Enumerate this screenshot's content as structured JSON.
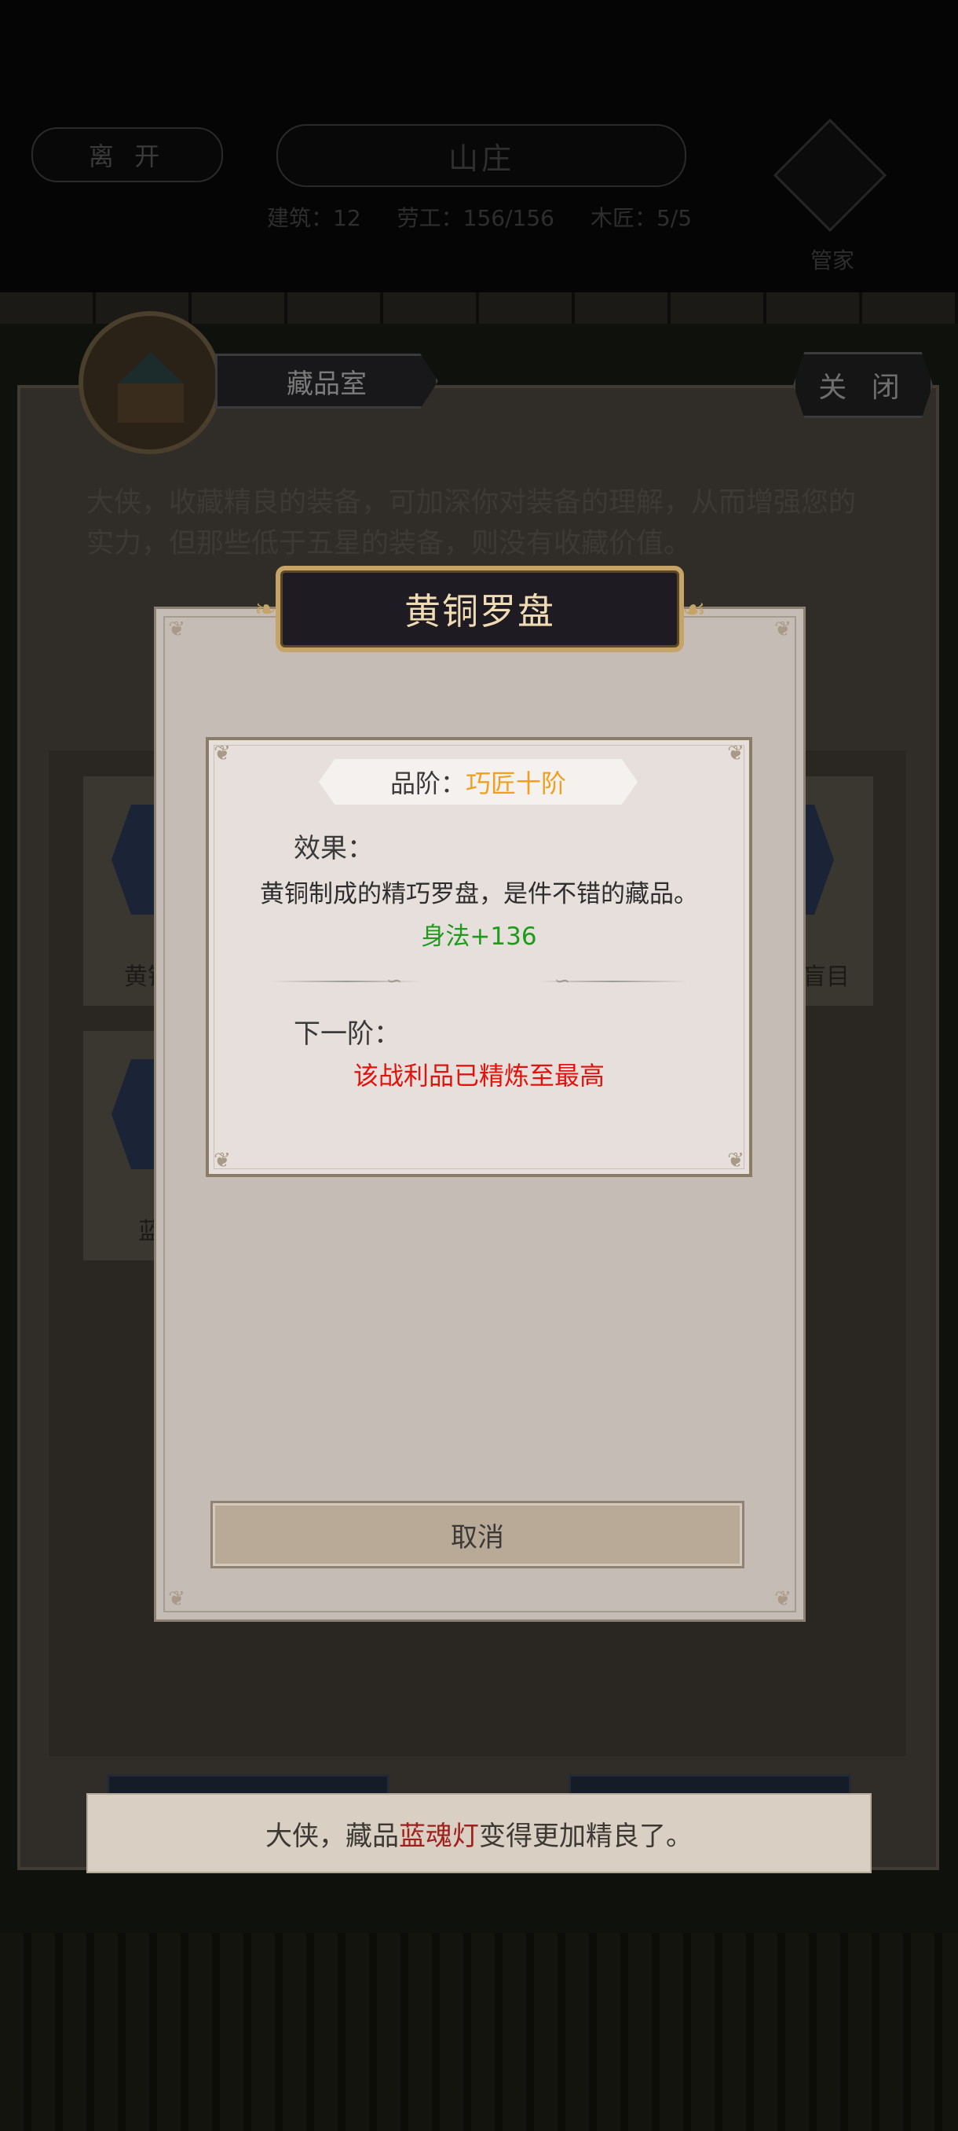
{
  "header": {
    "leave_label": "离 开",
    "title": "山庄",
    "stats": [
      "建筑：12",
      "劳工：156/156",
      "木匠：5/5"
    ],
    "steward_label": "管家"
  },
  "room": {
    "tab_label": "藏品室",
    "close_label": "关 闭",
    "description": "大侠，收藏精良的装备，可加深你对装备的理解，从而增强您的实力，但那些低于五星的装备，则没有收藏价值。",
    "card_labels": [
      "黄铜",
      "盲目",
      "蓝"
    ]
  },
  "modal": {
    "title": "黄铜罗盘",
    "grade_label": "品阶：",
    "grade_value": "巧匠十阶",
    "effect_label": "效果：",
    "effect_desc": "黄铜制成的精巧罗盘，是件不错的藏品。",
    "effect_stat": "身法+136",
    "next_label": "下一阶：",
    "next_desc": "该战利品已精炼至最高",
    "cancel_label": "取消"
  },
  "toast": {
    "prefix": "大侠，藏品",
    "item": "蓝魂灯",
    "suffix": "变得更加精良了。"
  },
  "colors": {
    "grade": "#f0a020",
    "stat_green": "#1f9a1a",
    "max_red": "#e0140d",
    "toast_item": "#a0201c",
    "title_gold": "#c6a367"
  }
}
